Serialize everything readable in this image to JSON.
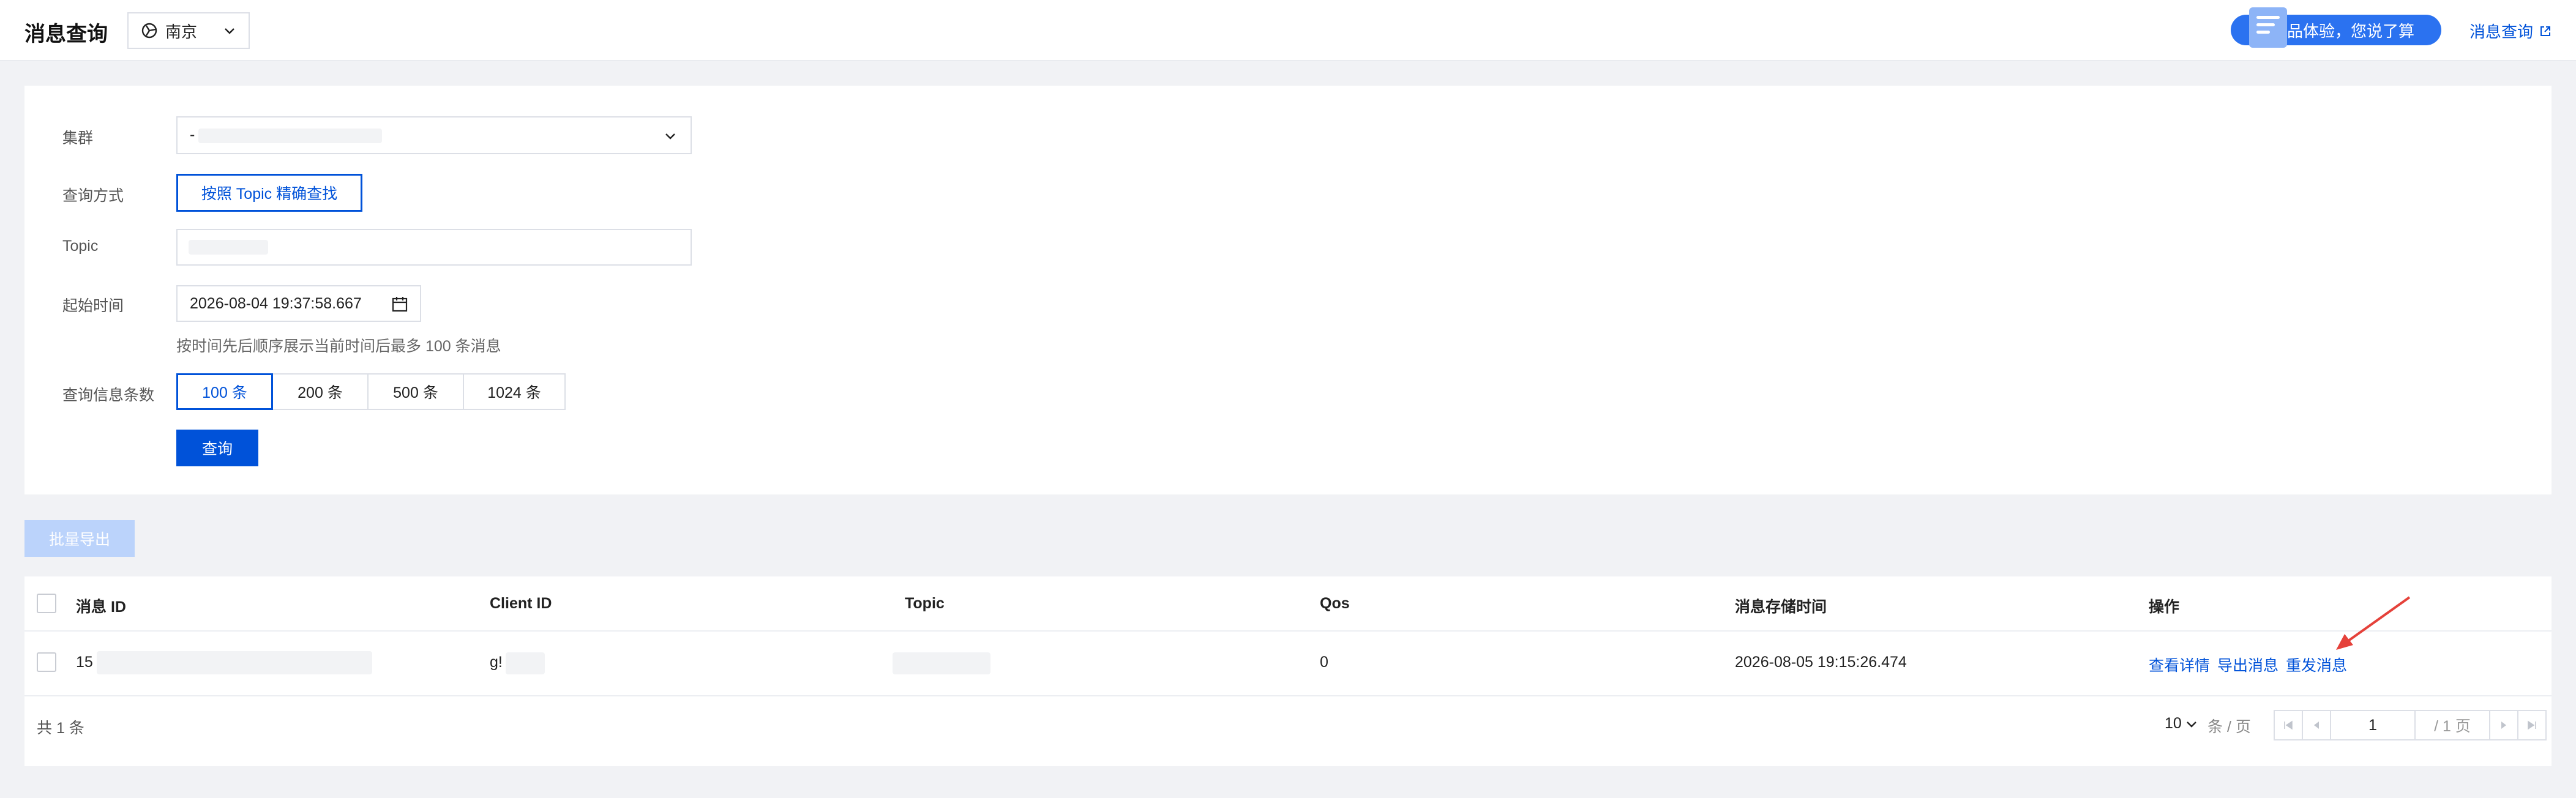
{
  "header": {
    "title": "消息查询",
    "region": "南京",
    "feedback": "产品体验，您说了算",
    "doc_link": "消息查询"
  },
  "form": {
    "cluster_label": "集群",
    "cluster_value": "-",
    "mode_label": "查询方式",
    "mode_button": "按照 Topic 精确查找",
    "topic_label": "Topic",
    "start_label": "起始时间",
    "start_value": "2026-08-04 19:37:58.667",
    "hint": "按时间先后顺序展示当前时间后最多 100 条消息",
    "count_label": "查询信息条数",
    "count_options": [
      "100 条",
      "200 条",
      "500 条",
      "1024 条"
    ],
    "count_selected": "100 条",
    "query_button": "查询"
  },
  "batch_export": "批量导出",
  "table": {
    "columns": [
      "消息 ID",
      "Client ID",
      "Topic",
      "Qos",
      "消息存储时间",
      "操作"
    ],
    "rows": [
      {
        "message_id": "15",
        "client_id": "g!",
        "topic": "",
        "qos": "0",
        "stored_at": "2026-08-05 19:15:26.474",
        "actions": [
          "查看详情",
          "导出消息",
          "重发消息"
        ]
      }
    ]
  },
  "pagination": {
    "total": "共 1 条",
    "page_size": "10",
    "page_size_unit": "条 / 页",
    "current_page": "1",
    "page_total": "/ 1 页"
  },
  "colors": {
    "primary": "#0052d9",
    "disabled_button": "#bbd3fb",
    "annotation_arrow": "#e5413a"
  }
}
